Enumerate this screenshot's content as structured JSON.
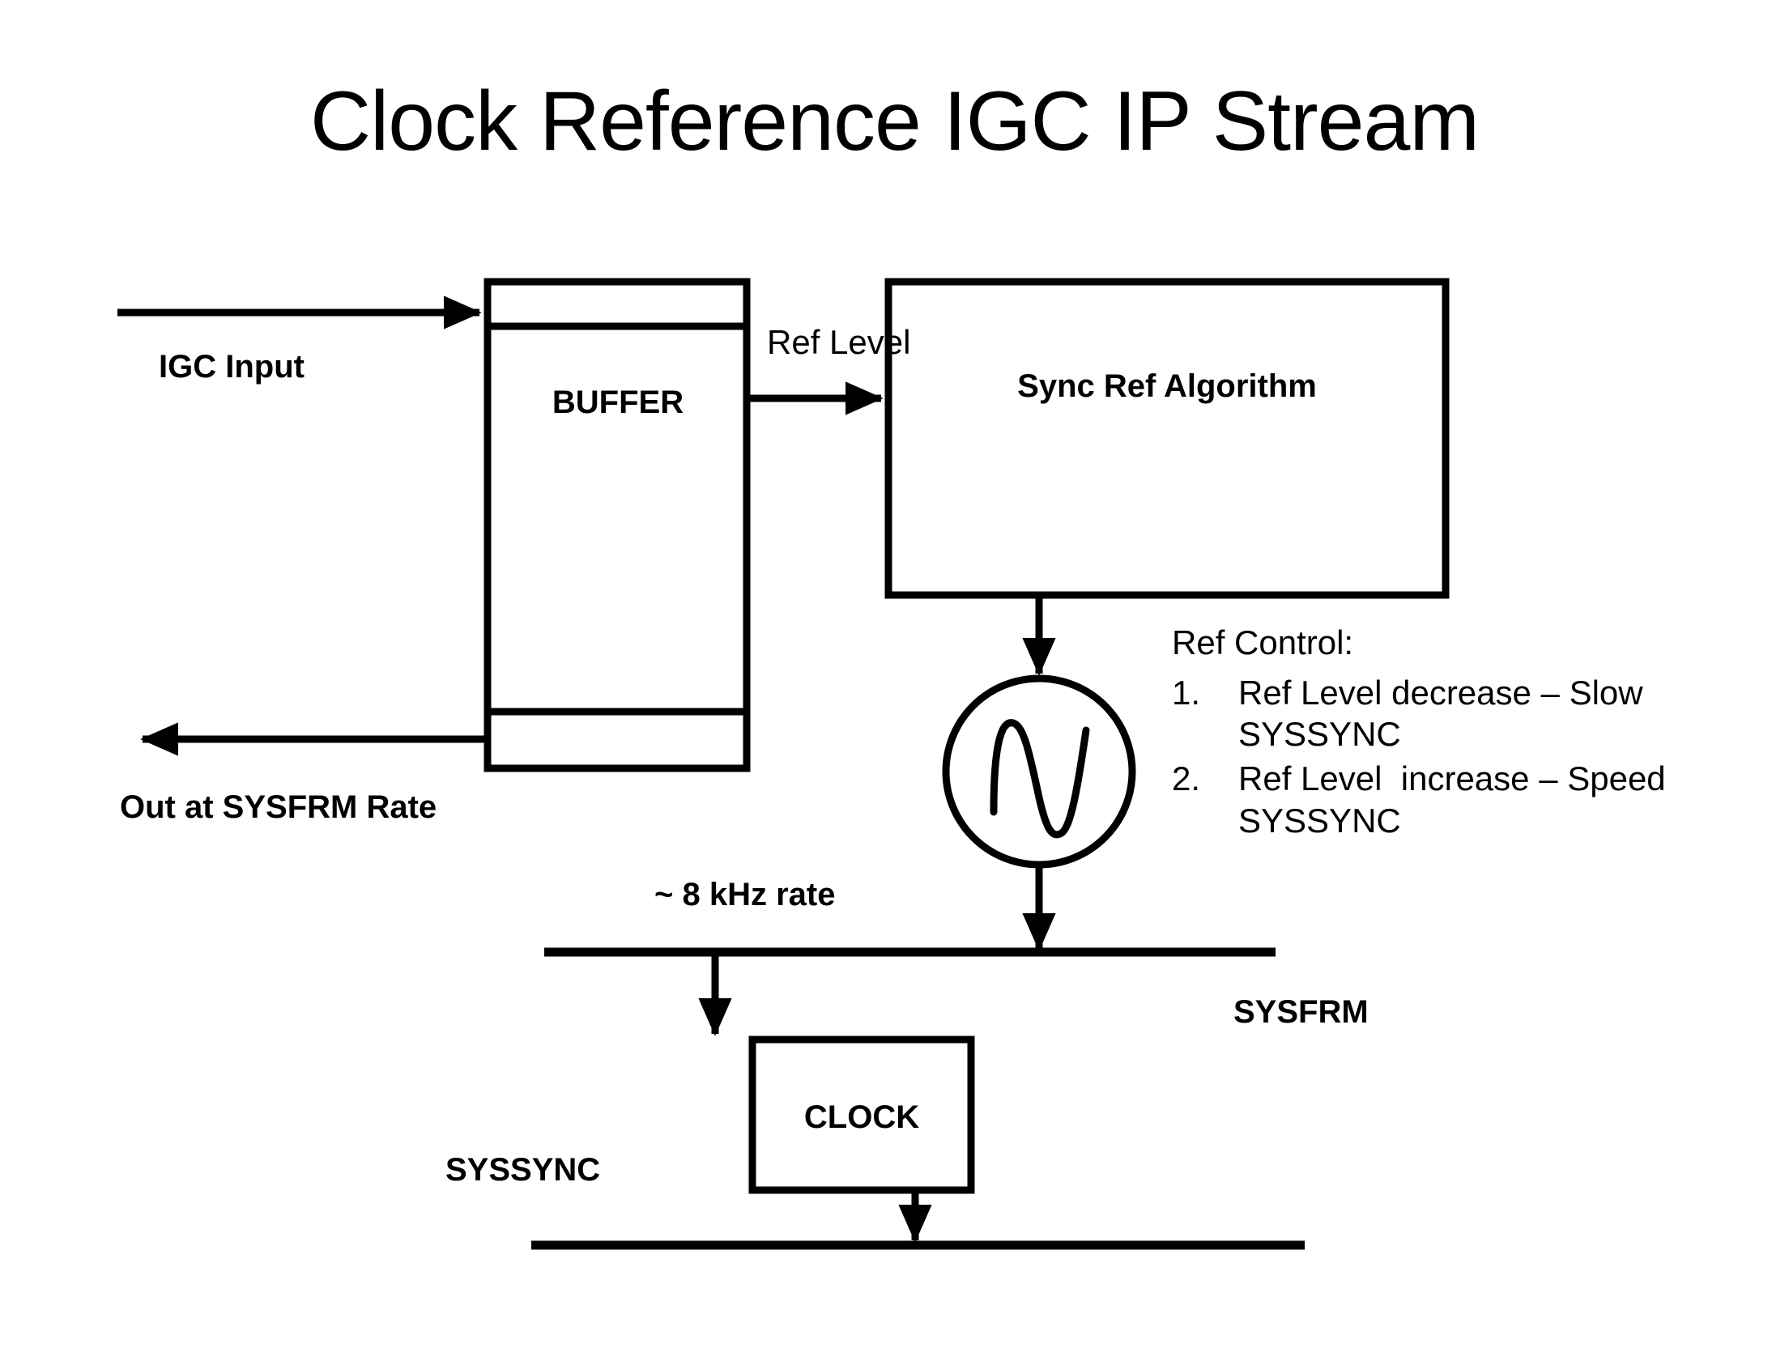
{
  "slide": {
    "title": "Clock Reference IGC IP Stream"
  },
  "diagram": {
    "type": "block-diagram",
    "stroke_color": "#000000",
    "background_color": "#ffffff",
    "blocks": [
      {
        "id": "buffer",
        "label": "BUFFER"
      },
      {
        "id": "sync_ref",
        "label": "Sync Ref Algorithm"
      },
      {
        "id": "clock",
        "label": "CLOCK"
      },
      {
        "id": "oscillator",
        "label": "oscillator-waveform-symbol"
      }
    ],
    "labels": {
      "igc_input": "IGC Input",
      "buffer": "BUFFER",
      "ref_level": "Ref Level",
      "sync_ref_algorithm": "Sync Ref Algorithm",
      "out_at_sysfrm_rate": "Out at SYSFRM Rate",
      "rate_8khz": "~ 8 kHz rate",
      "sysfrm": "SYSFRM",
      "syssync": "SYSSYNC",
      "clock": "CLOCK"
    },
    "ref_control": {
      "title": "Ref Control:",
      "items": [
        {
          "number": "1.",
          "text": "Ref Level decrease – Slow SYSSYNC"
        },
        {
          "number": "2.",
          "text": "Ref Level  increase – Speed SYSSYNC"
        }
      ]
    }
  }
}
